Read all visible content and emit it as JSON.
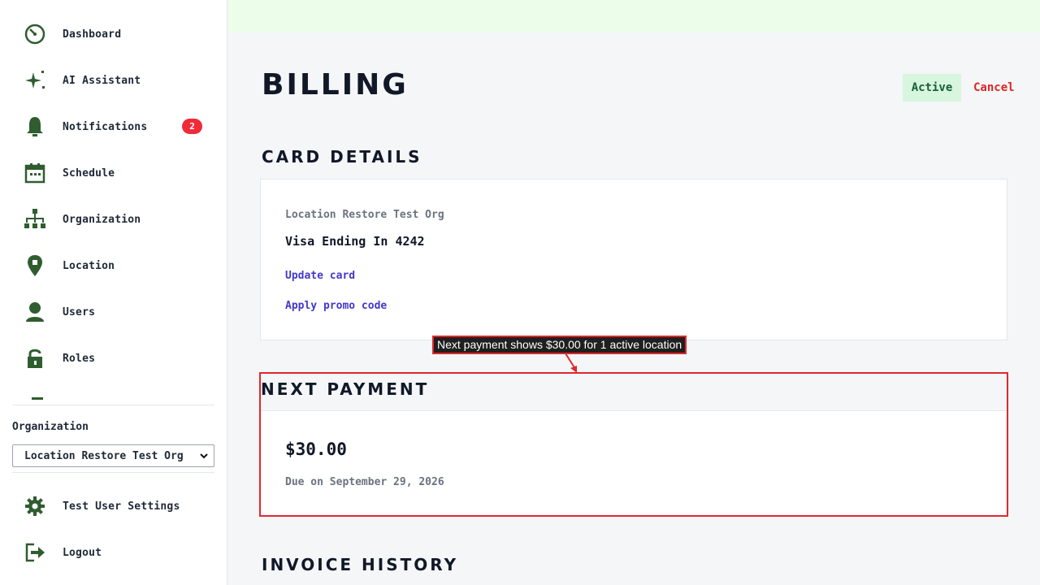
{
  "sidebar": {
    "items": [
      {
        "label": "Dashboard",
        "icon": "dashboard-icon"
      },
      {
        "label": "AI Assistant",
        "icon": "sparkle-icon"
      },
      {
        "label": "Notifications",
        "icon": "bell-icon",
        "badge": "2"
      },
      {
        "label": "Schedule",
        "icon": "calendar-icon"
      },
      {
        "label": "Organization",
        "icon": "org-chart-icon"
      },
      {
        "label": "Location",
        "icon": "location-pin-icon"
      },
      {
        "label": "Users",
        "icon": "user-icon"
      },
      {
        "label": "Roles",
        "icon": "lock-icon"
      }
    ],
    "org_label": "Organization",
    "org_selected": "Location Restore Test Org",
    "settings_label": "Test User Settings",
    "logout_label": "Logout",
    "icon_color": "#2f5d2f"
  },
  "main": {
    "title": "BILLING",
    "status": "Active",
    "cancel_label": "Cancel",
    "card_details": {
      "heading": "CARD DETAILS",
      "org_name": "Location Restore Test Org",
      "card_text": "Visa Ending In 4242",
      "update_link": "Update card",
      "promo_link": "Apply promo code"
    },
    "next_payment": {
      "heading": "NEXT PAYMENT",
      "amount": "$30.00",
      "due": "Due on September 29, 2026"
    },
    "invoice_history": {
      "heading": "INVOICE HISTORY"
    },
    "annotation": "Next payment shows $30.00 for 1 active location"
  },
  "colors": {
    "accent_green": "#16603a",
    "danger": "#dc2626",
    "link": "#4338ca",
    "highlight": "#e0282e"
  }
}
